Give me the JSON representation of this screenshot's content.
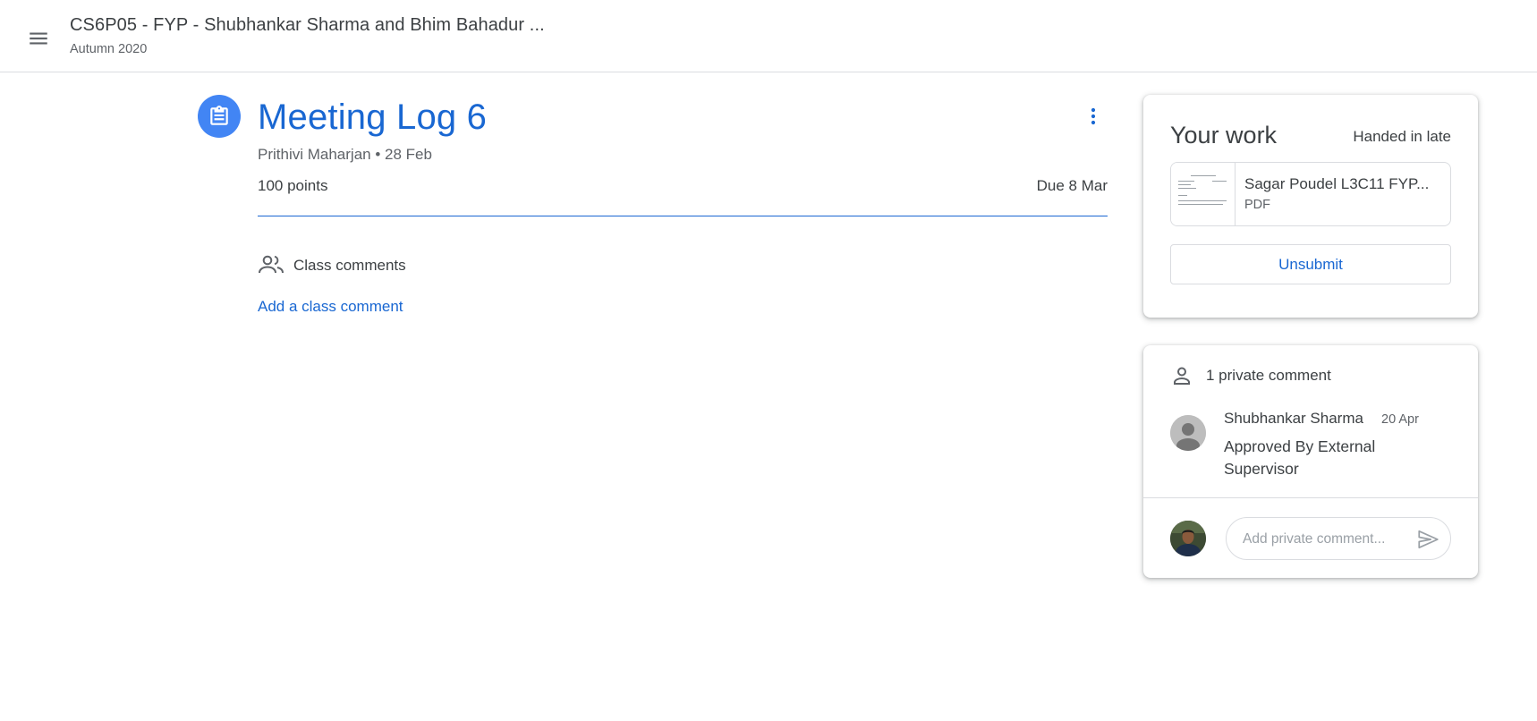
{
  "header": {
    "class_title": "CS6P05 - FYP - Shubhankar Sharma and Bhim Bahadur ...",
    "class_subtitle": "Autumn 2020"
  },
  "assignment": {
    "title": "Meeting Log 6",
    "meta": "Prithivi Maharjan • 28 Feb",
    "points": "100 points",
    "due": "Due 8 Mar"
  },
  "class_comments": {
    "label": "Class comments",
    "add_link": "Add a class comment"
  },
  "your_work": {
    "title": "Your work",
    "status": "Handed in late",
    "attachment": {
      "name": "Sagar Poudel L3C11 FYP...",
      "type": "PDF"
    },
    "unsubmit_label": "Unsubmit"
  },
  "private_comments": {
    "label": "1 private comment",
    "comments": [
      {
        "author": "Shubhankar Sharma",
        "date": "20 Apr",
        "text": "Approved By External Supervisor"
      }
    ],
    "input_placeholder": "Add private comment..."
  },
  "colors": {
    "accent": "#1967d2",
    "assignment_icon_bg": "#4285f4",
    "border": "#dadce0",
    "text_primary": "#3c4043",
    "text_secondary": "#5f6368"
  }
}
